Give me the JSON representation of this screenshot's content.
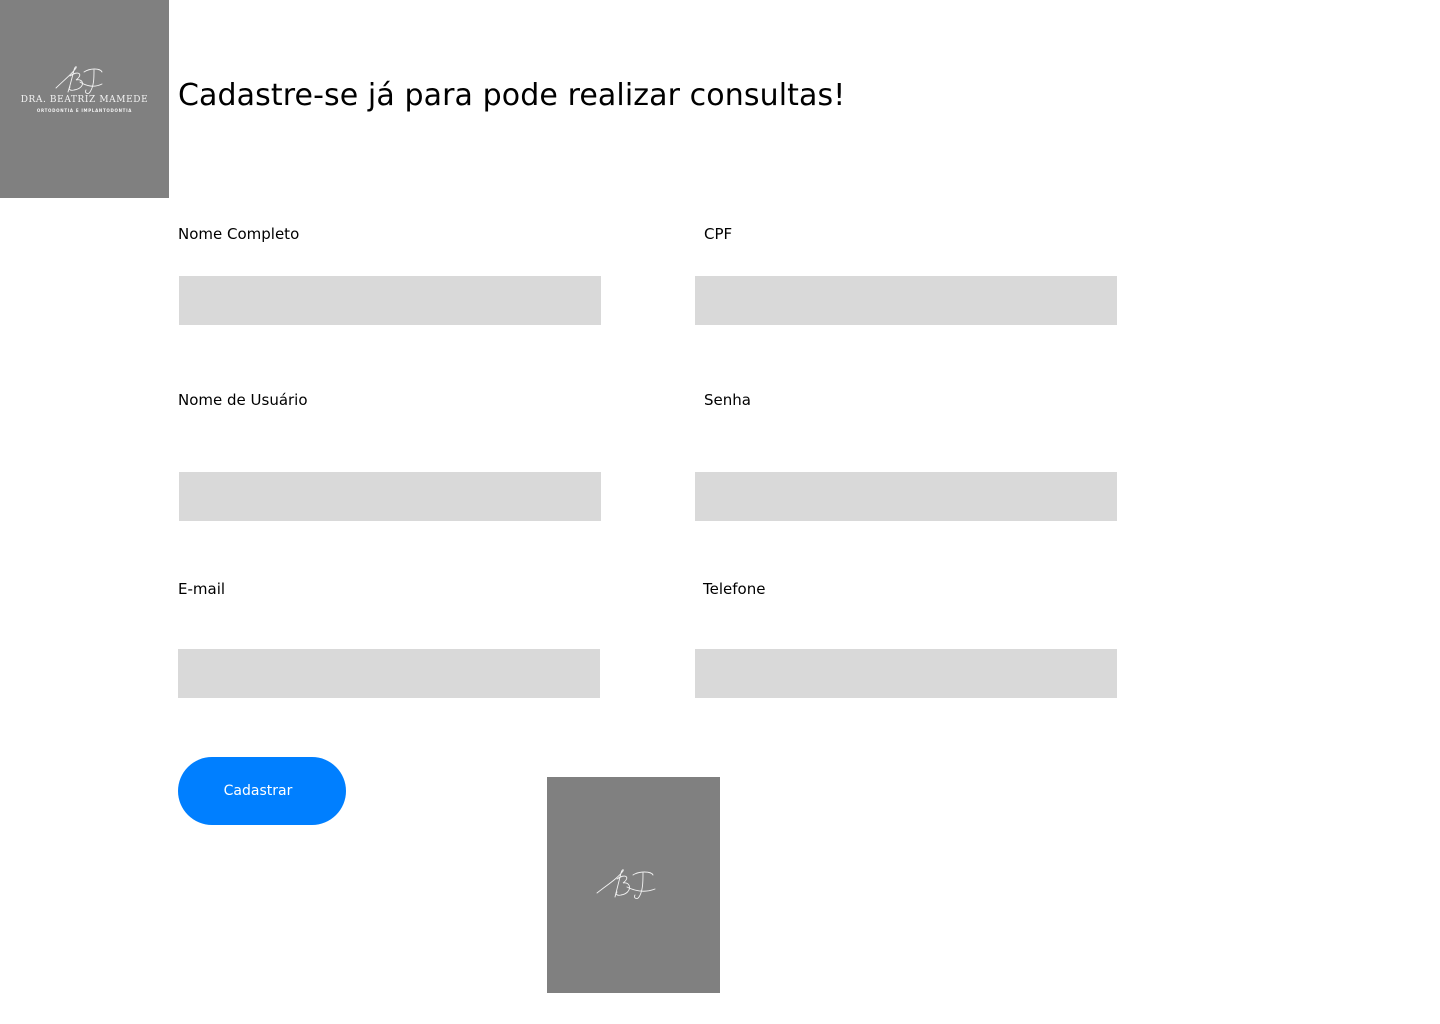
{
  "brand": {
    "name": "DRA. BEATRIZ MAMEDE",
    "tagline": "ORTODONTIA E IMPLANTODONTIA",
    "monogram_icon": "bm-signature-monogram-icon",
    "logo_background": "#808080"
  },
  "header": {
    "title": "Cadastre-se já para pode realizar consultas!"
  },
  "form": {
    "fields": [
      {
        "label": "Nome Completo",
        "value": "",
        "placeholder": ""
      },
      {
        "label": "CPF",
        "value": "",
        "placeholder": ""
      },
      {
        "label": "Nome de Usuário",
        "value": "",
        "placeholder": ""
      },
      {
        "label": "Senha",
        "value": "",
        "placeholder": ""
      },
      {
        "label": "E-mail",
        "value": "",
        "placeholder": ""
      },
      {
        "label": "Telefone",
        "value": "",
        "placeholder": ""
      }
    ],
    "submit_label": "Cadastrar",
    "input_background": "#d9d9d9",
    "accent_color": "#007fff"
  }
}
